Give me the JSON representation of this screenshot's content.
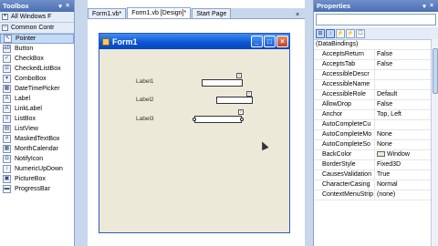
{
  "toolbox": {
    "title": "Toolbox",
    "pin": "▾",
    "close": "×",
    "groups": [
      {
        "sign": "+",
        "label": "All Windows F"
      },
      {
        "sign": "−",
        "label": "Common Contr"
      }
    ],
    "items": [
      {
        "label": "Pointer",
        "icon": "pointer-icon",
        "glyph": "↖"
      },
      {
        "label": "Button",
        "icon": "button-icon",
        "glyph": "ab"
      },
      {
        "label": "CheckBox",
        "icon": "checkbox-icon",
        "glyph": "✓"
      },
      {
        "label": "CheckedListBox",
        "icon": "checked-listbox-icon",
        "glyph": "☰"
      },
      {
        "label": "ComboBox",
        "icon": "combobox-icon",
        "glyph": "▾"
      },
      {
        "label": "DateTimePicker",
        "icon": "datetimepicker-icon",
        "glyph": "▦"
      },
      {
        "label": "Label",
        "icon": "label-icon",
        "glyph": "A"
      },
      {
        "label": "LinkLabel",
        "icon": "linklabel-icon",
        "glyph": "A"
      },
      {
        "label": "ListBox",
        "icon": "listbox-icon",
        "glyph": "≡"
      },
      {
        "label": "ListView",
        "icon": "listview-icon",
        "glyph": "▤"
      },
      {
        "label": "MaskedTextBox",
        "icon": "maskedtextbox-icon",
        "glyph": "#"
      },
      {
        "label": "MonthCalendar",
        "icon": "monthcalendar-icon",
        "glyph": "▦"
      },
      {
        "label": "NotifyIcon",
        "icon": "notifyicon-icon",
        "glyph": "◘"
      },
      {
        "label": "NumericUpDown",
        "icon": "numericupdown-icon",
        "glyph": "↕"
      },
      {
        "label": "PictureBox",
        "icon": "picturebox-icon",
        "glyph": "▣"
      },
      {
        "label": "ProgressBar",
        "icon": "progressbar-icon",
        "glyph": "▬"
      }
    ]
  },
  "tabs": [
    {
      "label": "Form1.vb*"
    },
    {
      "label": "Form1.vb [Design]*"
    },
    {
      "label": "Start Page"
    }
  ],
  "tab_close": "×",
  "form": {
    "title": "Form1",
    "min": "_",
    "max": "□",
    "close": "×",
    "labels": [
      "Label1",
      "Label2",
      "Label3"
    ]
  },
  "properties": {
    "title": "Properties",
    "pin": "▾",
    "close": "×",
    "toolbar": [
      "⊞",
      "↕",
      "⚡",
      "⚡",
      "☐"
    ],
    "rows": [
      {
        "name": "(DataBindings)",
        "value": "",
        "group": true
      },
      {
        "name": "AcceptsReturn",
        "value": "False"
      },
      {
        "name": "AcceptsTab",
        "value": "False"
      },
      {
        "name": "AccessibleDescr",
        "value": ""
      },
      {
        "name": "AccessibleName",
        "value": ""
      },
      {
        "name": "AccessibleRole",
        "value": "Default"
      },
      {
        "name": "AllowDrop",
        "value": "False"
      },
      {
        "name": "Anchor",
        "value": "Top, Left"
      },
      {
        "name": "AutoCompleteCu",
        "value": ""
      },
      {
        "name": "AutoCompleteMo",
        "value": "None"
      },
      {
        "name": "AutoCompleteSo",
        "value": "None"
      },
      {
        "name": "BackColor",
        "value": "Window",
        "swatch": true
      },
      {
        "name": "BorderStyle",
        "value": "Fixed3D"
      },
      {
        "name": "CausesValidation",
        "value": "True"
      },
      {
        "name": "CharacterCasing",
        "value": "Normal"
      },
      {
        "name": "ContextMenuStrip",
        "value": "(none)"
      }
    ]
  }
}
